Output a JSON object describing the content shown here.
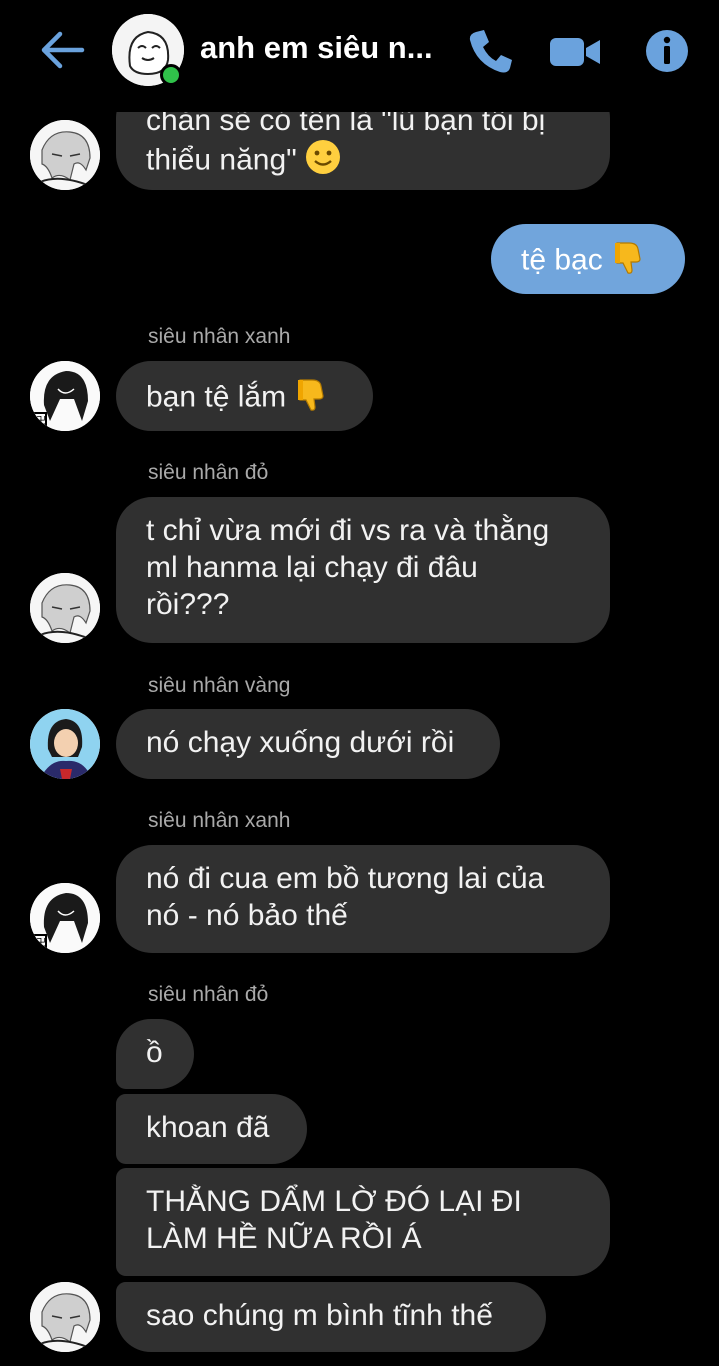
{
  "header": {
    "title": "anh em siêu n...",
    "back_icon": "arrow-left-icon",
    "call_icon": "phone-icon",
    "video_icon": "video-camera-icon",
    "info_icon": "info-icon",
    "accent_color": "#6aa2dd",
    "online_color": "#30c24a"
  },
  "messages": [
    {
      "type": "incoming",
      "text_line1": "chắn sẽ có tên là \"lũ bạn tôi bị",
      "text_line2": "thiểu năng\"",
      "emoji": "slightly-smiling-face-icon"
    },
    {
      "type": "outgoing",
      "text": "tệ bạc",
      "emoji": "thumbs-down-icon"
    },
    {
      "type": "incoming",
      "sender": "siêu nhân xanh",
      "text": "bạn tệ lắm",
      "emoji": "thumbs-down-icon"
    },
    {
      "type": "incoming",
      "sender": "siêu nhân đỏ",
      "text_line1": "t chỉ vừa mới đi vs ra và thằng",
      "text_line2": "ml hanma lại chạy đi đâu",
      "text_line3": "rồi???"
    },
    {
      "type": "incoming",
      "sender": "siêu nhân vàng",
      "text": "nó chạy xuống dưới rồi"
    },
    {
      "type": "incoming",
      "sender": "siêu nhân xanh",
      "text_line1": "nó đi cua em bồ tương lai của",
      "text_line2": "nó - nó bảo thế"
    },
    {
      "type": "incoming",
      "sender": "siêu nhân đỏ",
      "text": "ồ"
    },
    {
      "type": "incoming",
      "text": "khoan đã"
    },
    {
      "type": "incoming",
      "text_line1": "THẰNG DẨM LỜ ĐÓ LẠI ĐI",
      "text_line2": "LÀM HỀ NỮA RỒI Á"
    },
    {
      "type": "incoming",
      "text": "sao chúng m bình tĩnh thế"
    }
  ],
  "bubble_color": "#303030",
  "outgoing_bubble_color": "#71a5dc",
  "sender_color": "#a9a9a9"
}
